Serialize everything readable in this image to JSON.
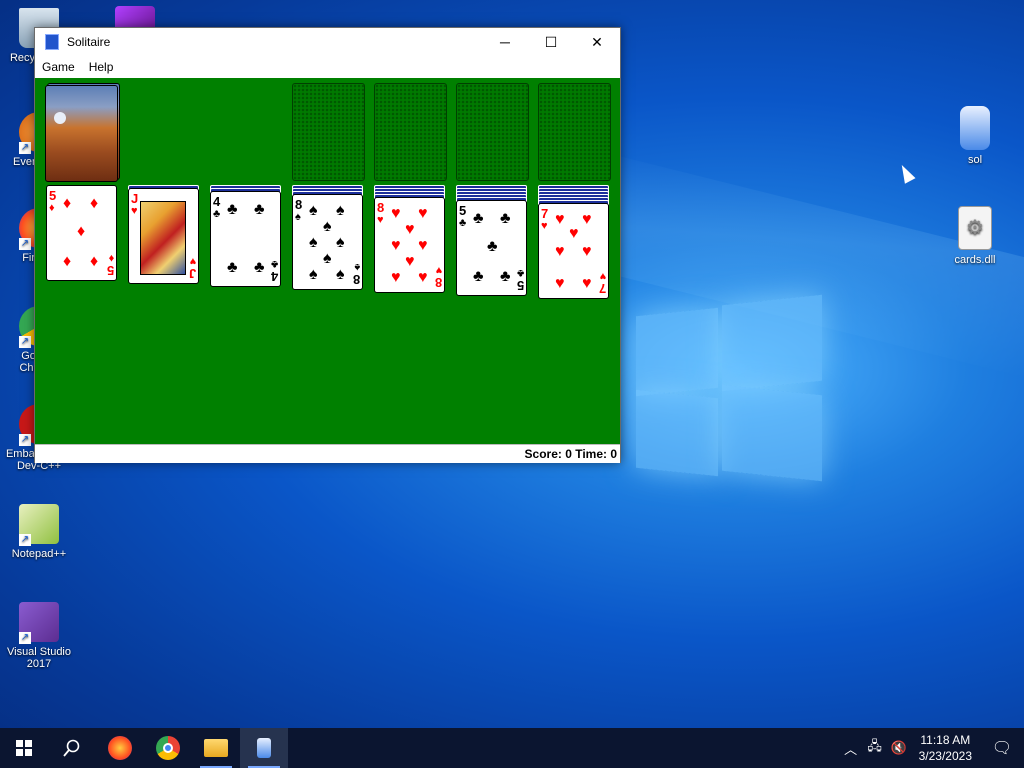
{
  "desktop": {
    "icons": [
      {
        "label": "Recycle Bin",
        "icon": "recycle-bin-icon"
      },
      {
        "label": "Everything",
        "icon": "everything-icon"
      },
      {
        "label": "Firefox",
        "icon": "firefox-icon"
      },
      {
        "label": "Google Chrome",
        "icon": "chrome-icon"
      },
      {
        "label": "Embarcadero Dev-C++",
        "icon": "devcpp-icon"
      },
      {
        "label": "Notepad++",
        "icon": "notepadpp-icon"
      },
      {
        "label": "Visual Studio 2017",
        "icon": "visual-studio-icon"
      },
      {
        "label": "sol",
        "icon": "sol-exe-icon"
      },
      {
        "label": "cards.dll",
        "icon": "dll-file-icon"
      }
    ]
  },
  "window": {
    "title": "Solitaire",
    "menu": [
      "Game",
      "Help"
    ],
    "status": "Score: 0 Time: 0",
    "colors": {
      "felt": "#008000",
      "red_suit": "#ff0000"
    }
  },
  "game": {
    "stock": "face-down deck",
    "foundations": [
      "empty",
      "empty",
      "empty",
      "empty"
    ],
    "tableau": [
      {
        "hidden": 0,
        "top": {
          "rank": "5",
          "suit": "♦",
          "color": "red"
        }
      },
      {
        "hidden": 1,
        "top": {
          "rank": "J",
          "suit": "♥",
          "color": "red"
        }
      },
      {
        "hidden": 2,
        "top": {
          "rank": "4",
          "suit": "♣",
          "color": "black"
        }
      },
      {
        "hidden": 3,
        "top": {
          "rank": "8",
          "suit": "♠",
          "color": "black"
        }
      },
      {
        "hidden": 4,
        "top": {
          "rank": "8",
          "suit": "♥",
          "color": "red"
        }
      },
      {
        "hidden": 5,
        "top": {
          "rank": "5",
          "suit": "♣",
          "color": "black"
        }
      },
      {
        "hidden": 6,
        "top": {
          "rank": "7",
          "suit": "♥",
          "color": "red"
        }
      }
    ]
  },
  "taskbar": {
    "apps": [
      "start-icon",
      "search-icon",
      "firefox-icon",
      "chrome-icon",
      "file-explorer-icon",
      "solitaire-icon"
    ],
    "time": "11:18 AM",
    "date": "3/23/2023"
  }
}
